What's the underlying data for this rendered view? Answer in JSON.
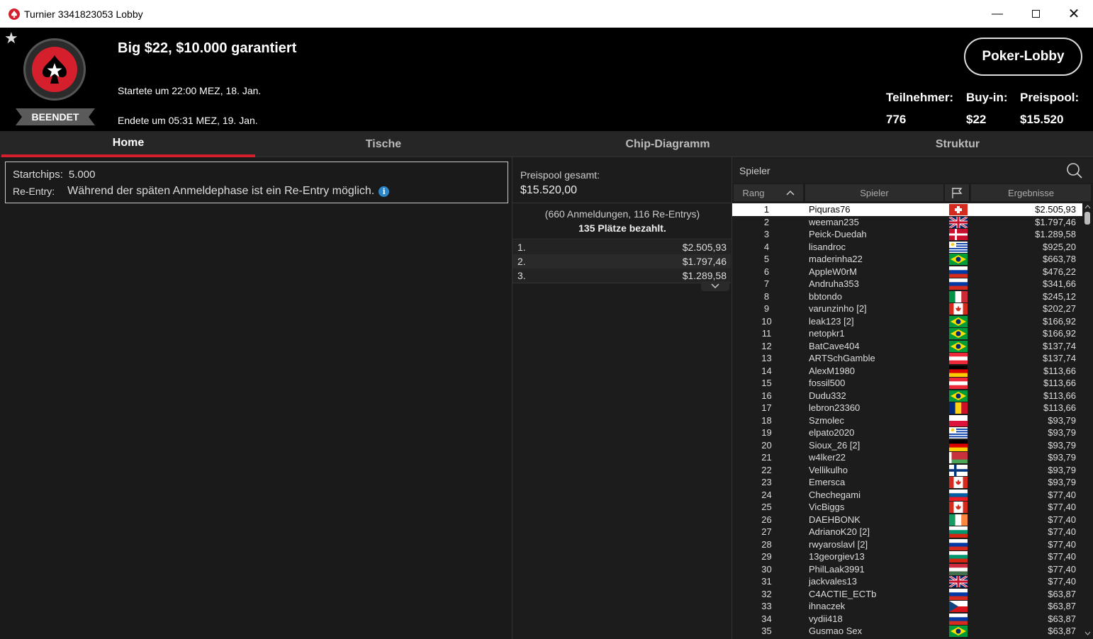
{
  "window": {
    "title": "Turnier 3341823053 Lobby"
  },
  "header": {
    "status": "BEENDET",
    "title": "Big $22, $10.000 garantiert",
    "start": "Startete um 22:00 MEZ, 18. Jan.",
    "end": "Endete um 05:31 MEZ, 19. Jan.",
    "lobby_button": "Poker-Lobby",
    "stats": [
      {
        "label": "Teilnehmer:",
        "value": "776"
      },
      {
        "label": "Buy-in:",
        "value": "$22"
      },
      {
        "label": "Preispool:",
        "value": "$15.520"
      }
    ]
  },
  "tabs": [
    {
      "label": "Home",
      "active": true
    },
    {
      "label": "Tische",
      "active": false
    },
    {
      "label": "Chip-Diagramm",
      "active": false
    },
    {
      "label": "Struktur",
      "active": false
    }
  ],
  "info": {
    "startchips_label": "Startchips:",
    "startchips_value": "5.000",
    "reentry_label": "Re-Entry:",
    "reentry_value": "Während der späten Anmeldephase ist ein Re-Entry möglich."
  },
  "prizepool": {
    "label": "Preispool gesamt:",
    "value": "$15.520,00",
    "registrations": "(660 Anmeldungen, 116 Re-Entrys)",
    "paid": "135 Plätze bezahlt.",
    "places": [
      {
        "place": "1.",
        "amount": "$2.505,93"
      },
      {
        "place": "2.",
        "amount": "$1.797,46"
      },
      {
        "place": "3.",
        "amount": "$1.289,58"
      }
    ]
  },
  "players": {
    "search_label": "Spieler",
    "columns": {
      "rank": "Rang",
      "player": "Spieler",
      "results": "Ergebnisse"
    },
    "rows": [
      {
        "rank": "1",
        "name": "Piquras76",
        "flag": "ch",
        "result": "$2.505,93"
      },
      {
        "rank": "2",
        "name": "weeman235",
        "flag": "gb",
        "result": "$1.797,46"
      },
      {
        "rank": "3",
        "name": "Peick-Duedah",
        "flag": "dk",
        "result": "$1.289,58"
      },
      {
        "rank": "4",
        "name": "lisandroc",
        "flag": "uy",
        "result": "$925,20"
      },
      {
        "rank": "5",
        "name": "maderinha22",
        "flag": "br",
        "result": "$663,78"
      },
      {
        "rank": "6",
        "name": "AppleW0rM",
        "flag": "ru",
        "result": "$476,22"
      },
      {
        "rank": "7",
        "name": "Andruha353",
        "flag": "ru",
        "result": "$341,66"
      },
      {
        "rank": "8",
        "name": "bbtondo",
        "flag": "it",
        "result": "$245,12"
      },
      {
        "rank": "9",
        "name": "varunzinho [2]",
        "flag": "ca",
        "result": "$202,27"
      },
      {
        "rank": "10",
        "name": "leak123 [2]",
        "flag": "br",
        "result": "$166,92"
      },
      {
        "rank": "11",
        "name": "netopkr1",
        "flag": "br",
        "result": "$166,92"
      },
      {
        "rank": "12",
        "name": "BatCave404",
        "flag": "br",
        "result": "$137,74"
      },
      {
        "rank": "13",
        "name": "ARTSchGamble",
        "flag": "at",
        "result": "$137,74"
      },
      {
        "rank": "14",
        "name": "AlexM1980",
        "flag": "de",
        "result": "$113,66"
      },
      {
        "rank": "15",
        "name": "fossil500",
        "flag": "at",
        "result": "$113,66"
      },
      {
        "rank": "16",
        "name": "Dudu332",
        "flag": "br",
        "result": "$113,66"
      },
      {
        "rank": "17",
        "name": "lebron23360",
        "flag": "ro",
        "result": "$113,66"
      },
      {
        "rank": "18",
        "name": "Szmolec",
        "flag": "pl",
        "result": "$93,79"
      },
      {
        "rank": "19",
        "name": "elpato2020",
        "flag": "uy",
        "result": "$93,79"
      },
      {
        "rank": "20",
        "name": "Sioux_26 [2]",
        "flag": "de",
        "result": "$93,79"
      },
      {
        "rank": "21",
        "name": "w4lker22",
        "flag": "by",
        "result": "$93,79"
      },
      {
        "rank": "22",
        "name": "Vellikulho",
        "flag": "fi",
        "result": "$93,79"
      },
      {
        "rank": "23",
        "name": "Emersca",
        "flag": "ca",
        "result": "$93,79"
      },
      {
        "rank": "24",
        "name": "Chechegami",
        "flag": "si",
        "result": "$77,40"
      },
      {
        "rank": "25",
        "name": "VicBiggs",
        "flag": "ca",
        "result": "$77,40"
      },
      {
        "rank": "26",
        "name": "DAEHBONK",
        "flag": "ie",
        "result": "$77,40"
      },
      {
        "rank": "27",
        "name": "AdrianoK20 [2]",
        "flag": "bg",
        "result": "$77,40"
      },
      {
        "rank": "28",
        "name": "rwyaroslavl [2]",
        "flag": "ru",
        "result": "$77,40"
      },
      {
        "rank": "29",
        "name": "13georgiev13",
        "flag": "bg",
        "result": "$77,40"
      },
      {
        "rank": "30",
        "name": "PhilLaak3991",
        "flag": "hu",
        "result": "$77,40"
      },
      {
        "rank": "31",
        "name": "jackvales13",
        "flag": "gb",
        "result": "$77,40"
      },
      {
        "rank": "32",
        "name": "C4ACTIE_ECTb",
        "flag": "ru",
        "result": "$63,87"
      },
      {
        "rank": "33",
        "name": "ihnaczek",
        "flag": "cz",
        "result": "$63,87"
      },
      {
        "rank": "34",
        "name": "vydii418",
        "flag": "ru",
        "result": "$63,87"
      },
      {
        "rank": "35",
        "name": "Gusmao Sex",
        "flag": "br",
        "result": "$63,87"
      }
    ]
  }
}
